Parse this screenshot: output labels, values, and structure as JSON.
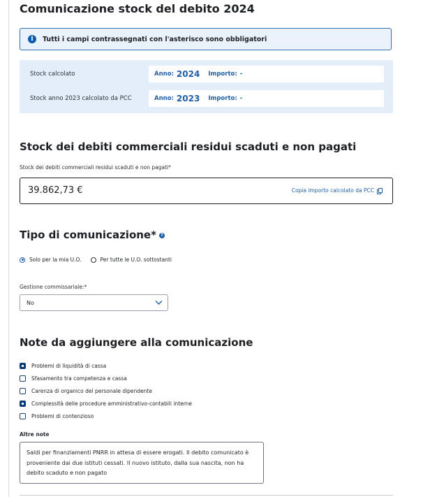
{
  "page_title": "Comunicazione stock del debito 2024",
  "info": {
    "icon": "info-icon",
    "text": "Tutti i campi contrassegnati con l'asterisco sono obbligatori"
  },
  "stock_rows": [
    {
      "label": "Stock calcolato",
      "anno_label": "Anno:",
      "anno": "2024",
      "importo_label": "Importo:",
      "importo": "-"
    },
    {
      "label": "Stock anno 2023 calcolato da PCC",
      "anno_label": "Anno:",
      "anno": "2023",
      "importo_label": "Importo:",
      "importo": "-"
    }
  ],
  "debiti_section": {
    "title": "Stock dei debiti commerciali residui scaduti e non pagati",
    "field_label": "Stock dei debiti commerciali residui scaduti e non pagati*",
    "amount": "39.862,73 €",
    "copy_link": "Copia importo calcolato da PCC",
    "copy_icon": "copy-icon"
  },
  "tipo_section": {
    "title": "Tipo di comunicazione*",
    "help_icon": "help-icon",
    "options": [
      {
        "label": "Solo per la mia U.O.",
        "selected": true
      },
      {
        "label": "Per tutte le U.O. sottostanti",
        "selected": false
      }
    ],
    "gestione_label": "Gestione commissariale:*",
    "gestione_value": "No",
    "chevron_icon": "chevron-down-icon"
  },
  "note_section": {
    "title": "Note da aggiungere alla comunicazione",
    "checkboxes": [
      {
        "label": "Problemi di liquidità di cassa",
        "checked": true
      },
      {
        "label": "Sfasamento tra competenza e cassa",
        "checked": false
      },
      {
        "label": "Carenza di organico del personale dipendente",
        "checked": false
      },
      {
        "label": "Complessità delle procedure amministrativo-contabili interne",
        "checked": true
      },
      {
        "label": "Problemi di contenzioso",
        "checked": false
      }
    ],
    "altre_note_label": "Altre note",
    "altre_note_value": "Saldi per finanziamenti PNRR in attesa di essere erogati. Il debito comunicato è proveniente dai due istituti cessati. Il nuovo istituto, dalla sua nascita, non ha debito scaduto e non pagato"
  },
  "colors": {
    "accent": "#1f5fa8",
    "info_bg": "#eaf3fc",
    "panel_bg": "#e3eefa",
    "checkbox_on": "#0b3d7a"
  }
}
